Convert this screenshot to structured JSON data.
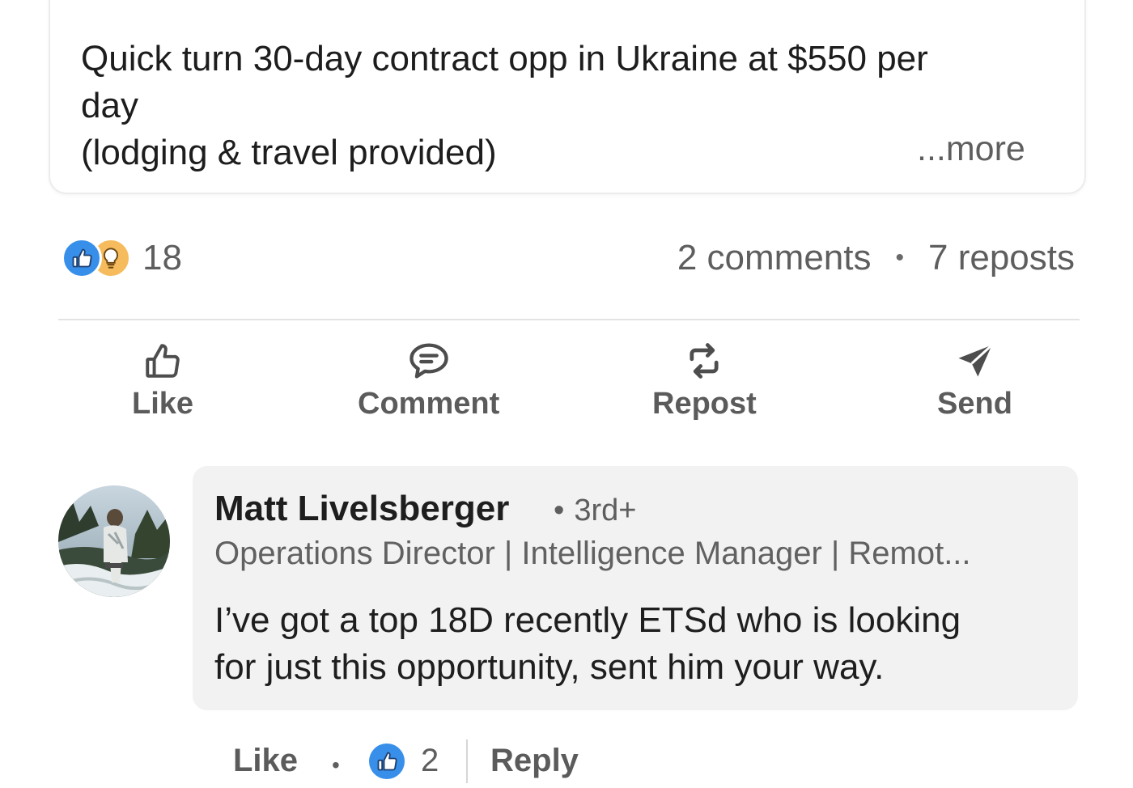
{
  "post": {
    "text_lines": [
      "Quick turn 30-day contract opp in Ukraine at $550 per",
      "day",
      "(lodging & travel provided)"
    ],
    "more_label": "...more"
  },
  "social_counts": {
    "reaction_icons": [
      "like-icon",
      "insightful-icon"
    ],
    "reactions": "18",
    "comments": "2 comments",
    "separator": "•",
    "reposts": "7 reposts"
  },
  "actions": [
    {
      "label": "Like",
      "icon": "thumbs-up-icon"
    },
    {
      "label": "Comment",
      "icon": "comment-bubble-icon"
    },
    {
      "label": "Repost",
      "icon": "repost-icon"
    },
    {
      "label": "Send",
      "icon": "send-icon"
    }
  ],
  "comment": {
    "author": "Matt Livelsberger",
    "separator": "•",
    "degree": "3rd+",
    "headline": "Operations Director | Intelligence Manager | Remot...",
    "text_lines": [
      "I’ve got a top 18D recently ETSd who is looking",
      "for just this opportunity, sent him your way."
    ],
    "like_label": "Like",
    "footer_separator": "•",
    "reaction_icon": "like-icon",
    "reaction_count": "2",
    "reply_label": "Reply"
  },
  "colors": {
    "like_blue": "#378fe9",
    "insightful_gold": "#f5bb5c",
    "comment_bubble_bg": "#f2f2f2",
    "secondary_text": "#5e5e5e"
  }
}
